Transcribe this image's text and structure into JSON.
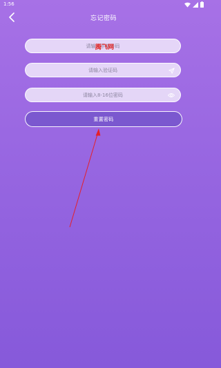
{
  "status_bar": {
    "time": "1:56"
  },
  "header": {
    "title": "忘记密码"
  },
  "form": {
    "phone_placeholder": "请输入手机号码",
    "code_placeholder": "请输入验证码",
    "password_placeholder": "请输入8-16位密码"
  },
  "watermark": "腾飞网",
  "buttons": {
    "reset_label": "重置密码"
  },
  "colors": {
    "gradient_top": "#a771e6",
    "gradient_bottom": "#8659da",
    "button_fill": "#7b58cf",
    "annotation_arrow": "#e4202a"
  },
  "icons": {
    "back": "chevron-left-icon",
    "send": "send-icon",
    "password_toggle": "eye-icon"
  }
}
